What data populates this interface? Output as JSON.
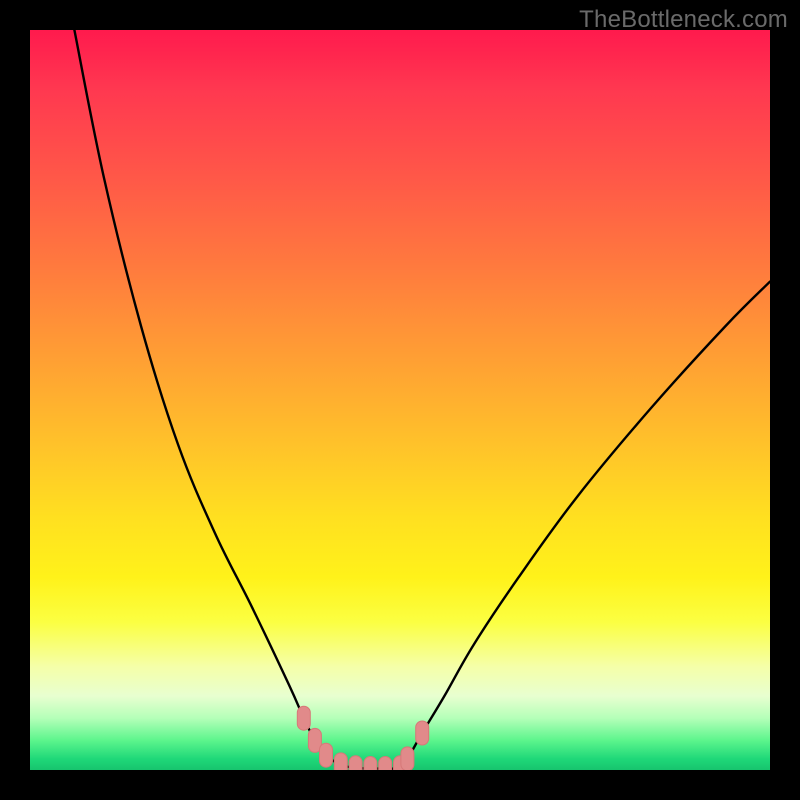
{
  "watermark": "TheBottleneck.com",
  "colors": {
    "background": "#000000",
    "gradient_top": "#ff1a4d",
    "gradient_bottom": "#17c46e",
    "curve_stroke": "#000000",
    "marker_fill": "#e18a8a",
    "marker_stroke": "#d77878"
  },
  "chart_data": {
    "type": "line",
    "title": "",
    "xlabel": "",
    "ylabel": "",
    "xlim": [
      0,
      100
    ],
    "ylim": [
      0,
      100
    ],
    "series": [
      {
        "name": "left-curve",
        "x": [
          6,
          10,
          15,
          20,
          25,
          30,
          35,
          37,
          38.5,
          40,
          42,
          44
        ],
        "values": [
          100,
          80,
          60,
          44,
          32,
          22,
          11.5,
          7,
          4,
          2,
          0.7,
          0.3
        ]
      },
      {
        "name": "valley-floor",
        "x": [
          44,
          46,
          48,
          50
        ],
        "values": [
          0.3,
          0.2,
          0.2,
          0.3
        ]
      },
      {
        "name": "right-curve",
        "x": [
          50,
          51,
          53,
          56,
          60,
          66,
          74,
          84,
          94,
          100
        ],
        "values": [
          0.3,
          1.5,
          5,
          10,
          17,
          26,
          37,
          49,
          60,
          66
        ]
      }
    ],
    "markers": [
      {
        "x": 37.0,
        "y": 7.0
      },
      {
        "x": 38.5,
        "y": 4.0
      },
      {
        "x": 40.0,
        "y": 2.0
      },
      {
        "x": 42.0,
        "y": 0.7
      },
      {
        "x": 44.0,
        "y": 0.3
      },
      {
        "x": 46.0,
        "y": 0.2
      },
      {
        "x": 48.0,
        "y": 0.2
      },
      {
        "x": 50.0,
        "y": 0.3
      },
      {
        "x": 51.0,
        "y": 1.5
      },
      {
        "x": 53.0,
        "y": 5.0
      }
    ],
    "axes_visible": false,
    "grid": false,
    "legend": false
  }
}
